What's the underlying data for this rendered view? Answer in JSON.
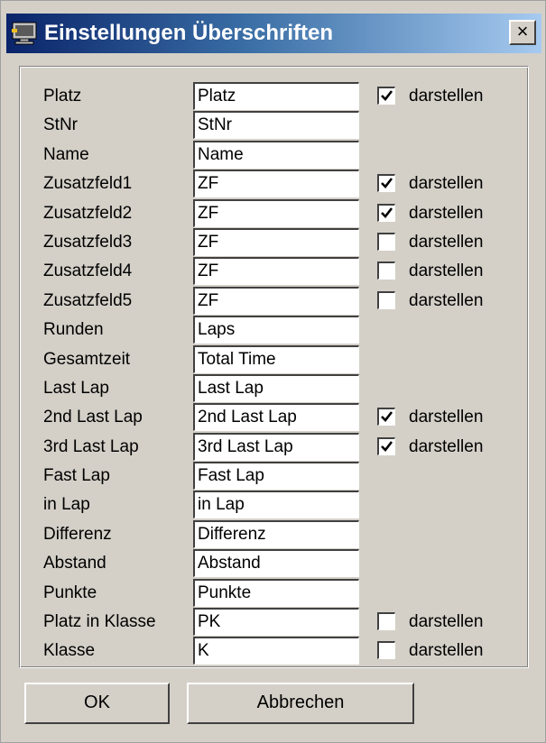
{
  "window": {
    "title": "Einstellungen Überschriften",
    "close_symbol": "×",
    "title_icon": "application-icon",
    "close_icon": "close-icon"
  },
  "fields": [
    {
      "label": "Platz",
      "value": "Platz",
      "has_check": true,
      "checked": true,
      "check_label": "darstellen"
    },
    {
      "label": "StNr",
      "value": "StNr",
      "has_check": false
    },
    {
      "label": "Name",
      "value": "Name",
      "has_check": false
    },
    {
      "label": "Zusatzfeld1",
      "value": "ZF",
      "has_check": true,
      "checked": true,
      "check_label": "darstellen"
    },
    {
      "label": "Zusatzfeld2",
      "value": "ZF",
      "has_check": true,
      "checked": true,
      "check_label": "darstellen"
    },
    {
      "label": "Zusatzfeld3",
      "value": "ZF",
      "has_check": true,
      "checked": false,
      "check_label": "darstellen"
    },
    {
      "label": "Zusatzfeld4",
      "value": "ZF",
      "has_check": true,
      "checked": false,
      "check_label": "darstellen"
    },
    {
      "label": "Zusatzfeld5",
      "value": "ZF",
      "has_check": true,
      "checked": false,
      "check_label": "darstellen"
    },
    {
      "label": "Runden",
      "value": "Laps",
      "has_check": false
    },
    {
      "label": "Gesamtzeit",
      "value": "Total Time",
      "has_check": false
    },
    {
      "label": "Last Lap",
      "value": "Last Lap",
      "has_check": false
    },
    {
      "label": "2nd Last Lap",
      "value": "2nd Last Lap",
      "has_check": true,
      "checked": true,
      "check_label": "darstellen"
    },
    {
      "label": "3rd Last Lap",
      "value": "3rd Last Lap",
      "has_check": true,
      "checked": true,
      "check_label": "darstellen"
    },
    {
      "label": "Fast Lap",
      "value": "Fast Lap",
      "has_check": false
    },
    {
      "label": "in Lap",
      "value": "in Lap",
      "has_check": false
    },
    {
      "label": "Differenz",
      "value": "Differenz",
      "has_check": false
    },
    {
      "label": "Abstand",
      "value": "Abstand",
      "has_check": false
    },
    {
      "label": "Punkte",
      "value": "Punkte",
      "has_check": false
    },
    {
      "label": "Platz in Klasse",
      "value": "PK",
      "has_check": true,
      "checked": false,
      "check_label": "darstellen"
    },
    {
      "label": "Klasse",
      "value": "K",
      "has_check": true,
      "checked": false,
      "check_label": "darstellen"
    }
  ],
  "buttons": {
    "ok_label": "OK",
    "cancel_label": "Abbrechen"
  },
  "colors": {
    "title_gradient_start": "#0a246a",
    "title_gradient_end": "#a6caf0",
    "dialog_background": "#d4d0c8"
  }
}
